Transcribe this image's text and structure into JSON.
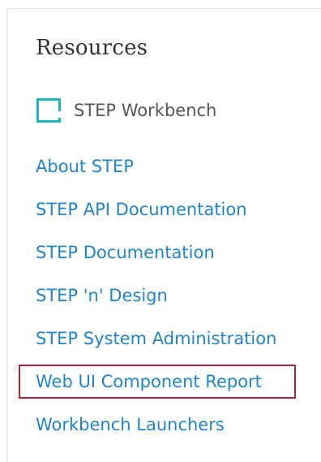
{
  "resources": {
    "title": "Resources",
    "app_item": {
      "label": "STEP Workbench",
      "icon": "workbench-icon",
      "icon_color": "#1fb5c4"
    },
    "links": [
      {
        "label": "About STEP"
      },
      {
        "label": "STEP API Documentation"
      },
      {
        "label": "STEP Documentation"
      },
      {
        "label": "STEP 'n' Design"
      },
      {
        "label": "STEP System Administration"
      },
      {
        "label": "Web UI Component Report"
      },
      {
        "label": "Workbench Launchers"
      }
    ],
    "link_color": "#1e84cc",
    "highlight_color": "#a8283a"
  }
}
